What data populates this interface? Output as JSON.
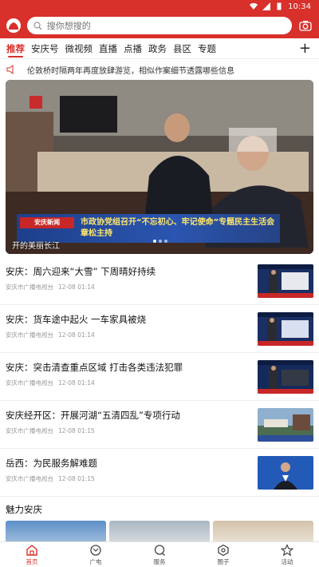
{
  "status_bar": {
    "time": "10:34"
  },
  "search": {
    "placeholder": "搜你想搜的"
  },
  "tabs": [
    {
      "label": "推荐"
    },
    {
      "label": "安庆号"
    },
    {
      "label": "微视频"
    },
    {
      "label": "直播"
    },
    {
      "label": "点播"
    },
    {
      "label": "政务"
    },
    {
      "label": "县区"
    },
    {
      "label": "专题"
    }
  ],
  "ticker": {
    "text": "伦敦桥时隔两年再度放肆游览，相似作案细节透露哪些信息"
  },
  "banner": {
    "tv_tag": "安庆新闻",
    "caption_line1": "市政协党组召开“不忘初心、牢记使命”专题民主生活会",
    "caption_line2": "章松主持",
    "bottom_text": "开的美丽长江"
  },
  "news": [
    {
      "title": "安庆：周六迎来“大雪” 下周晴好持续",
      "source": "安庆市广播电视台",
      "time": "12-08 01:14"
    },
    {
      "title": "安庆：货车途中起火 一车家具被烧",
      "source": "安庆市广播电视台",
      "time": "12-08 01:14"
    },
    {
      "title": "安庆：突击清查重点区域 打击各类违法犯罪",
      "source": "安庆市广播电视台",
      "time": "12-08 01:14"
    },
    {
      "title": "安庆经开区：开展河湖“五清四乱”专项行动",
      "source": "安庆市广播电视台",
      "time": "12-08 01:15"
    },
    {
      "title": "岳西：为民服务解难题",
      "source": "安庆市广播电视台",
      "time": "12-08 01:15"
    }
  ],
  "section": {
    "title": "魅力安庆"
  },
  "bottom_nav": [
    {
      "label": "首页",
      "icon": "home-icon"
    },
    {
      "label": "广电",
      "icon": "tv-icon"
    },
    {
      "label": "服务",
      "icon": "service-icon"
    },
    {
      "label": "圈子",
      "icon": "circle-icon"
    },
    {
      "label": "活动",
      "icon": "star-icon"
    }
  ],
  "colors": {
    "brand": "#d8302a"
  }
}
